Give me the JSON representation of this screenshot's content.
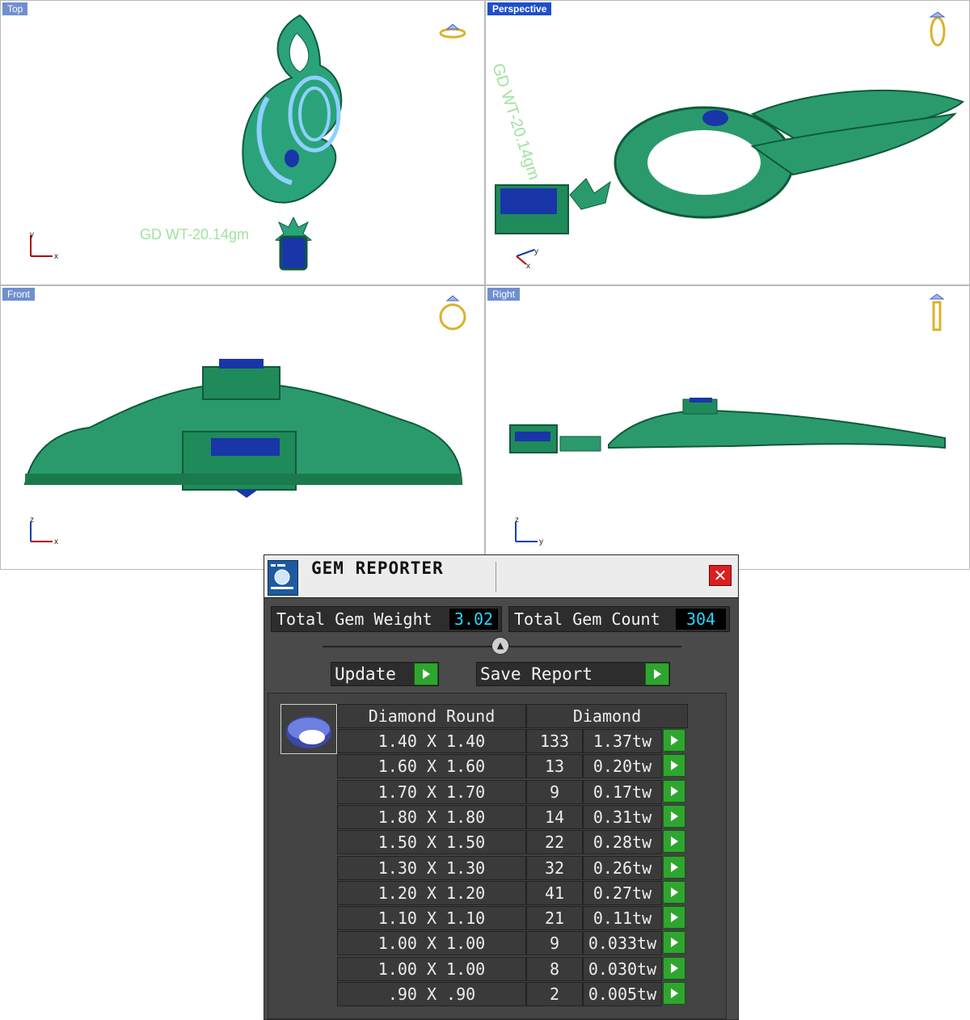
{
  "viewports": {
    "top": {
      "label": "Top",
      "watermark": "GD WT-20.14gm",
      "axis_v": "y",
      "axis_h": "x"
    },
    "perspective": {
      "label": "Perspective",
      "watermark": "GD WT-20.14gm",
      "axis_v": "y",
      "axis_h": "x"
    },
    "front": {
      "label": "Front",
      "axis_v": "z",
      "axis_h": "x"
    },
    "right": {
      "label": "Right",
      "axis_v": "z",
      "axis_h": "y"
    }
  },
  "colors": {
    "metal": "#1f8a5a",
    "gem_blue": "#7eb6f0",
    "center_stone": "#1936a8",
    "watermark": "#9fe29f"
  },
  "gem_reporter": {
    "title": "GEM REPORTER",
    "close_label": "✕",
    "total_weight_label": "Total Gem Weight",
    "total_weight": "3.02",
    "total_count_label": "Total Gem Count",
    "total_count": "304",
    "update_label": "Update",
    "save_label": "Save Report",
    "col_shape": "Diamond Round",
    "col_type": "Diamond",
    "rows": [
      {
        "size": "1.40 X 1.40",
        "count": "133",
        "weight": "1.37tw"
      },
      {
        "size": "1.60 X 1.60",
        "count": "13",
        "weight": "0.20tw"
      },
      {
        "size": "1.70 X 1.70",
        "count": "9",
        "weight": "0.17tw"
      },
      {
        "size": "1.80 X 1.80",
        "count": "14",
        "weight": "0.31tw"
      },
      {
        "size": "1.50 X 1.50",
        "count": "22",
        "weight": "0.28tw"
      },
      {
        "size": "1.30 X 1.30",
        "count": "32",
        "weight": "0.26tw"
      },
      {
        "size": "1.20 X 1.20",
        "count": "41",
        "weight": "0.27tw"
      },
      {
        "size": "1.10 X 1.10",
        "count": "21",
        "weight": "0.11tw"
      },
      {
        "size": "1.00 X 1.00",
        "count": "9",
        "weight": "0.033tw"
      },
      {
        "size": "1.00 X 1.00",
        "count": "8",
        "weight": "0.030tw"
      },
      {
        "size": ".90 X .90",
        "count": "2",
        "weight": "0.005tw"
      }
    ]
  }
}
